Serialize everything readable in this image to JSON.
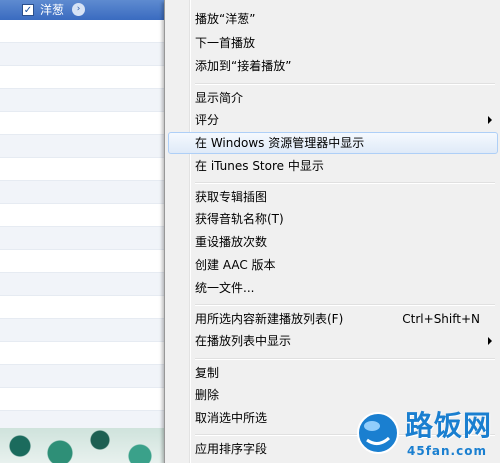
{
  "song_list": {
    "selected_title": "洋葱",
    "selected_checked": true
  },
  "context_menu": {
    "items": [
      {
        "label": "播放“洋葱”"
      },
      {
        "label": "下一首播放"
      },
      {
        "label": "添加到“接着播放”"
      },
      {
        "label": "显示简介"
      },
      {
        "label": "评分",
        "submenu": true
      },
      {
        "label": "在 Windows 资源管理器中显示",
        "highlighted": true
      },
      {
        "label": "在 iTunes Store 中显示"
      },
      {
        "label": "获取专辑插图"
      },
      {
        "label": "获得音轨名称(T)"
      },
      {
        "label": "重设播放次数"
      },
      {
        "label": "创建 AAC 版本"
      },
      {
        "label": "统一文件..."
      },
      {
        "label": "用所选内容新建播放列表(F)",
        "shortcut": "Ctrl+Shift+N"
      },
      {
        "label": "在播放列表中显示",
        "submenu": true
      },
      {
        "label": "复制"
      },
      {
        "label": "删除"
      },
      {
        "label": "取消选中所选"
      },
      {
        "label": "应用排序字段"
      }
    ]
  },
  "watermark": {
    "name": "路饭网",
    "url": "45fan.com"
  },
  "colors": {
    "selection": "#3a6bc0",
    "menu_bg": "#f0f0f0",
    "hover_border": "#aecff7",
    "watermark": "#1a7fd0"
  }
}
